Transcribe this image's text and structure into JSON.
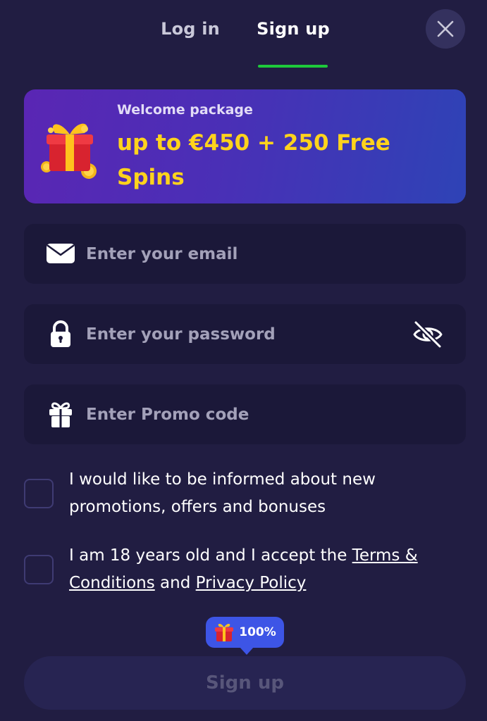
{
  "tabs": {
    "login": "Log in",
    "signup": "Sign up"
  },
  "close_icon": "close-icon",
  "banner": {
    "subtitle": "Welcome package",
    "title": "up to €450 + 250 Free Spins",
    "icon": "gift-box-icon"
  },
  "form": {
    "email": {
      "placeholder": "Enter your email",
      "value": "",
      "icon": "envelope-icon"
    },
    "password": {
      "placeholder": "Enter your password",
      "value": "",
      "icon": "lock-icon",
      "toggle_icon": "eye-off-icon"
    },
    "promo": {
      "placeholder": "Enter Promo code",
      "value": "",
      "icon": "gift-icon"
    }
  },
  "consents": {
    "promotions": {
      "text": "I would like to be informed about new promotions, offers and bonuses",
      "checked": false
    },
    "terms": {
      "prefix": "I am 18 years old and I accept the ",
      "terms_link": "Terms & Conditions",
      "middle": " and ",
      "privacy_link": "Privacy Policy",
      "checked": false
    }
  },
  "badge": {
    "text": "100%",
    "icon": "gift-icon"
  },
  "submit_label": "Sign up",
  "colors": {
    "background": "#211d42",
    "field": "#1b1839",
    "accent_green": "#1ec93b",
    "accent_yellow": "#ffd31c",
    "badge_blue": "#3d55e6"
  }
}
